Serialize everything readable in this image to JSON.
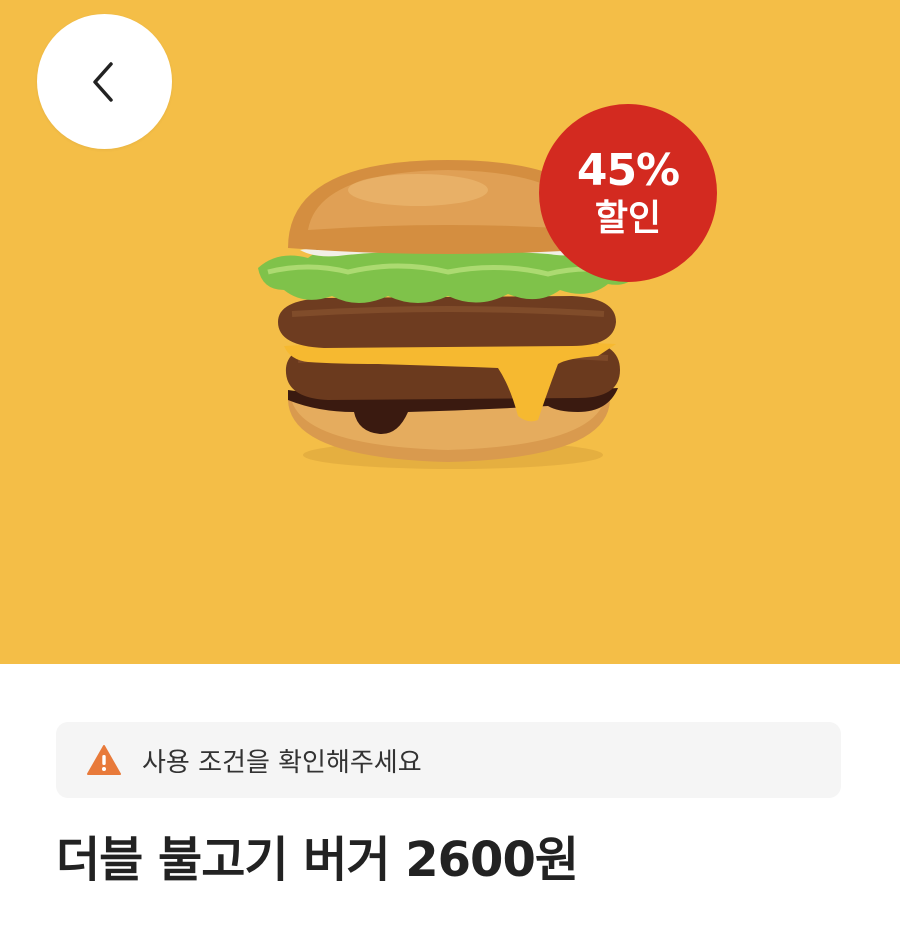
{
  "hero": {
    "background_color": "#F4BE47",
    "back_button": {
      "icon": "chevron-left-icon"
    },
    "image": {
      "subject": "double bulgogi burger"
    },
    "discount_badge": {
      "percent_text": "45%",
      "label": "할인",
      "color": "#D32A20"
    }
  },
  "notice": {
    "icon": "warning-icon",
    "icon_color": "#E87A3A",
    "text": "사용 조건을 확인해주세요"
  },
  "product": {
    "title": "더블 불고기 버거 2600원"
  }
}
